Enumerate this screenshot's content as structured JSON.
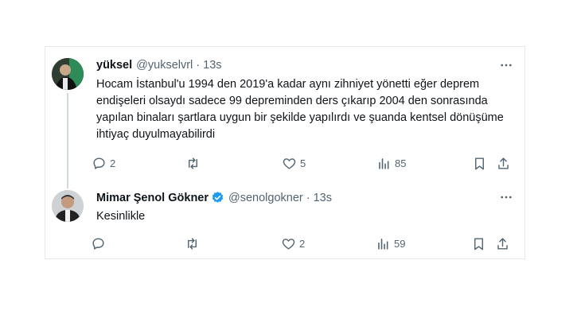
{
  "tweets": [
    {
      "name": "yüksel",
      "handle": "@yukselvrl",
      "separator": "·",
      "time": "13s",
      "text": "Hocam İstanbul'u 1994 den 2019'a kadar aynı zihniyet yönetti eğer deprem endişeleri olsaydı sadece 99 depreminden ders çıkarıp 2004 den sonrasında yapılan binaları şartlara uygun bir şekilde yapılırdı ve şuanda kentsel dönüşüme ihtiyaç duyulmayabilirdi",
      "reply_count": "2",
      "retweet_count": "",
      "like_count": "5",
      "view_count": "85"
    },
    {
      "name": "Mimar Şenol Gökner",
      "handle": "@senolgokner",
      "separator": "·",
      "time": "13s",
      "text": "Kesinlikle",
      "reply_count": "",
      "retweet_count": "",
      "like_count": "2",
      "view_count": "59",
      "verified_color": "#1d9bf0"
    }
  ]
}
